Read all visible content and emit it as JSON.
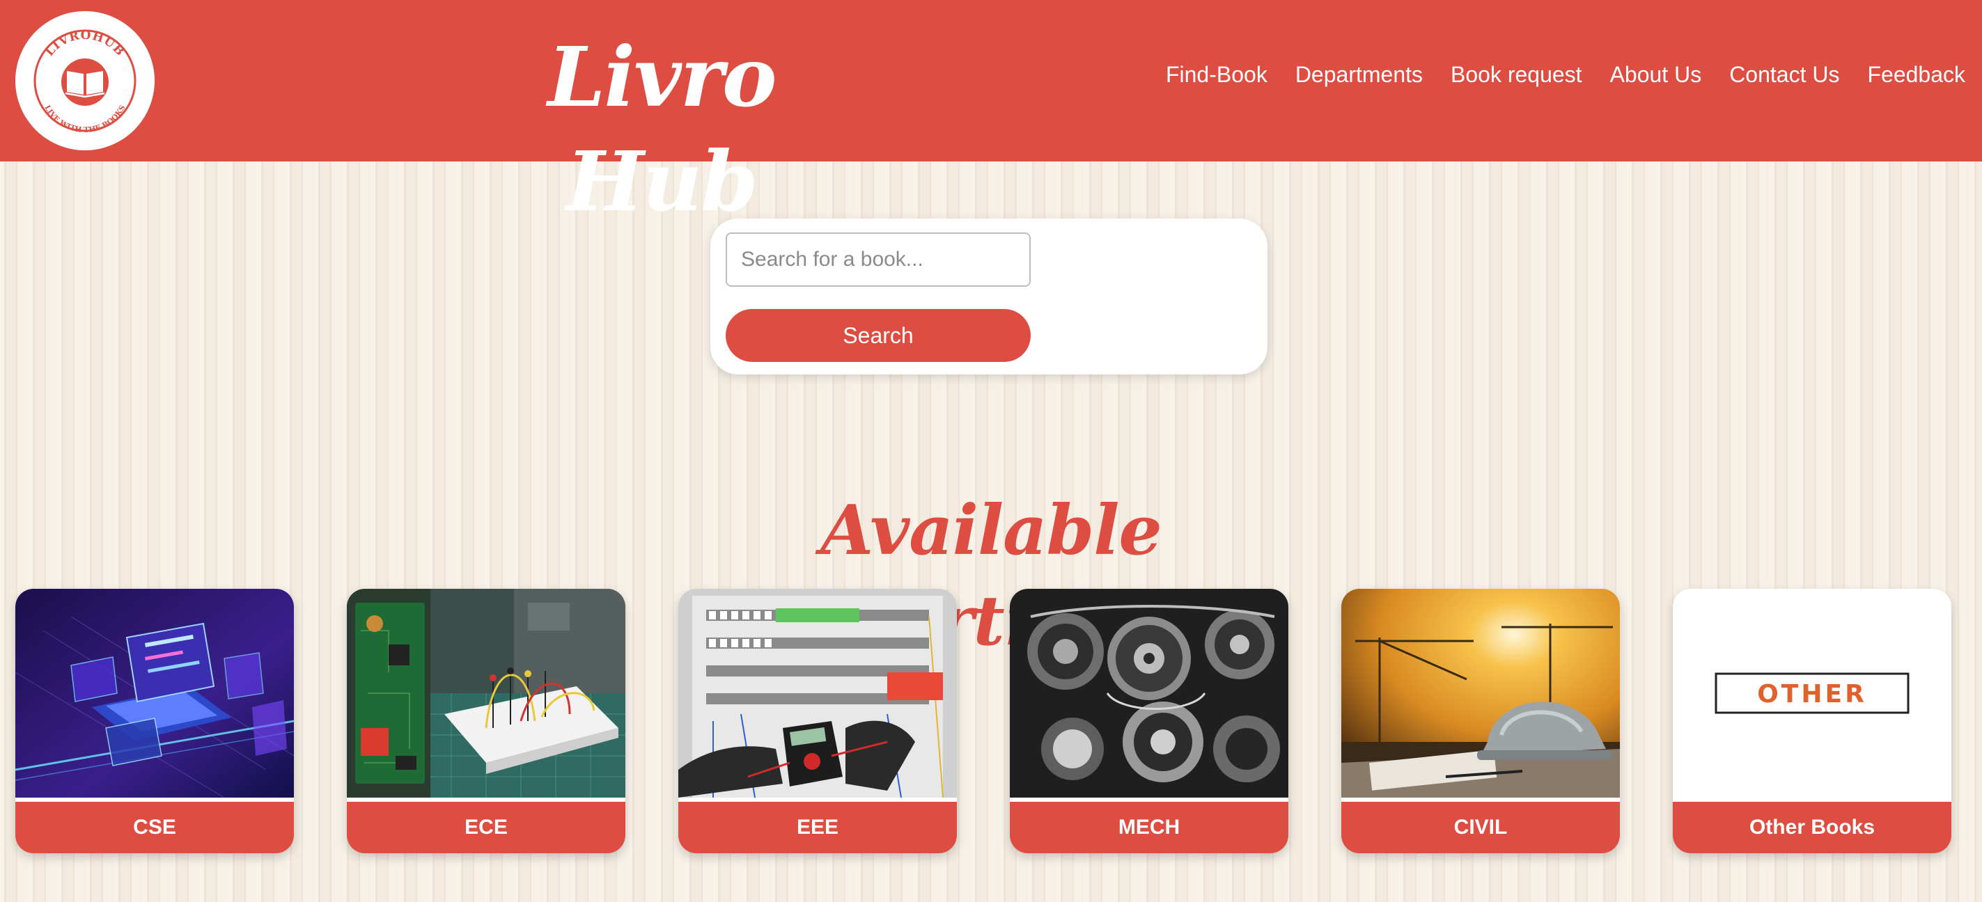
{
  "header": {
    "logo": {
      "top_text": "LIVROHUB",
      "bottom_text": "LIVE WITH THE BOOKS",
      "icon": "book-icon"
    },
    "title": "Livro Hub",
    "nav": [
      "Find-Book",
      "Departments",
      "Book request",
      "About Us",
      "Contact Us",
      "Feedback"
    ]
  },
  "search": {
    "placeholder": "Search for a book...",
    "button_label": "Search"
  },
  "departments": {
    "title": "Available Departments",
    "items": [
      {
        "label": "CSE",
        "image": "laptop-hologram-image"
      },
      {
        "label": "ECE",
        "image": "circuit-breadboard-image"
      },
      {
        "label": "EEE",
        "image": "electrical-panel-multimeter-image"
      },
      {
        "label": "MECH",
        "image": "engine-gears-image"
      },
      {
        "label": "CIVIL",
        "image": "construction-cranes-helmet-image"
      },
      {
        "label": "Other Books",
        "image": "other-image",
        "image_text": "OTHER"
      }
    ]
  },
  "colors": {
    "brand": "#dd4d42",
    "background": "#f3ebdf",
    "white": "#ffffff",
    "other_text": "#e0612c"
  }
}
